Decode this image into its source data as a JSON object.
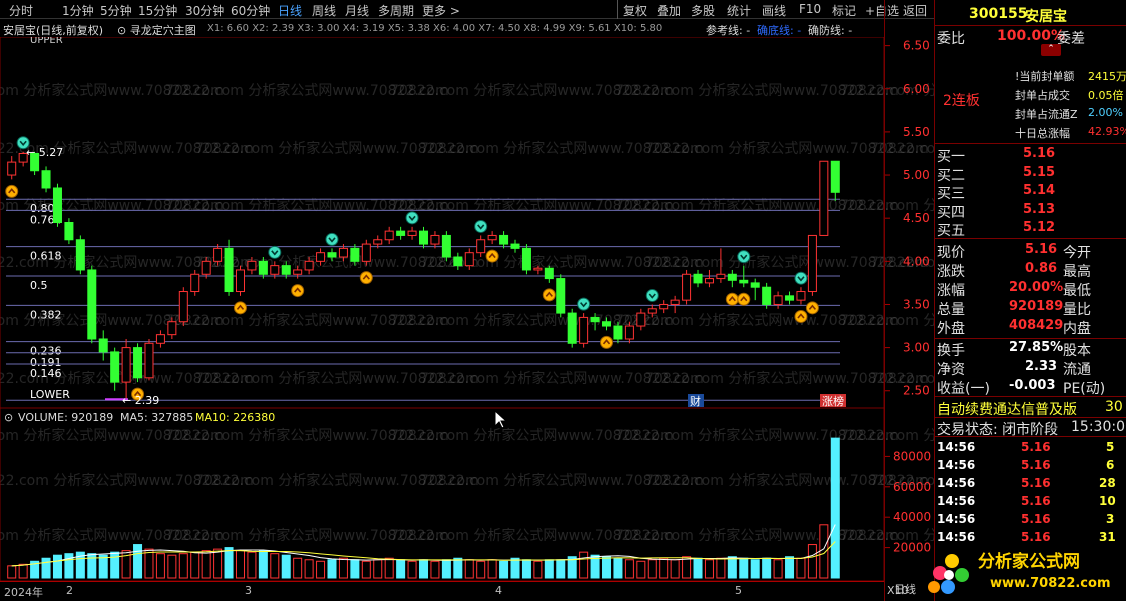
{
  "toolbar": {
    "items": [
      "分时",
      "1分钟",
      "5分钟",
      "15分钟",
      "30分钟",
      "60分钟",
      "日线",
      "周线",
      "月线",
      "多周期",
      "更多 >"
    ],
    "right_items": [
      "复权",
      "叠加",
      "多股",
      "统计",
      "画线",
      "F10",
      "标记",
      "+自选",
      "返回"
    ]
  },
  "infobar": {
    "stock": "安居宝(日线,前复权)",
    "indicator": "寻龙定穴主图",
    "params": "X1: 6.60  X2: 2.39  X3: 3.00  X4: 3.19  X5: 3.38  X6: 4.00  X7: 4.50  X8: 4.99  X9: 5.61  X10: 5.80",
    "ref": "参考线: -",
    "bottom_line": "确底线: -",
    "defense_line": "确防线: -"
  },
  "main_chart": {
    "y_ticks": [
      "6.50",
      "6.00",
      "5.50",
      "5.00",
      "4.50",
      "4.00",
      "3.50",
      "3.00",
      "2.50"
    ],
    "upper_label": "UPPER",
    "lower_label": "LOWER",
    "fib_labels": [
      "0.809",
      "0.764",
      "0.618",
      "0.5",
      "0.382",
      "0.236",
      "0.191",
      "0.146"
    ],
    "high_label": "5.27",
    "low_label": "2.39",
    "badge_cai": "财",
    "badge_zhangting": "涨榜"
  },
  "chart_data": {
    "type": "candlestick",
    "title": "",
    "ylim": [
      2.3,
      6.6
    ],
    "up_color": "#ff3333",
    "down_color": "#33ff33",
    "candles": [
      [
        5.0,
        5.15,
        5.22,
        4.95
      ],
      [
        5.15,
        5.25,
        5.27,
        5.1
      ],
      [
        5.25,
        5.05,
        5.27,
        5.0
      ],
      [
        5.05,
        4.85,
        5.1,
        4.8
      ],
      [
        4.85,
        4.45,
        4.9,
        4.4
      ],
      [
        4.45,
        4.25,
        4.5,
        4.2
      ],
      [
        4.25,
        3.9,
        4.3,
        3.85
      ],
      [
        3.9,
        3.1,
        3.95,
        3.05
      ],
      [
        3.1,
        2.95,
        3.2,
        2.85
      ],
      [
        2.95,
        2.6,
        3.0,
        2.5
      ],
      [
        2.6,
        3.0,
        3.1,
        2.39
      ],
      [
        3.0,
        2.65,
        3.05,
        2.6
      ],
      [
        2.65,
        3.05,
        3.1,
        2.62
      ],
      [
        3.05,
        3.15,
        3.2,
        3.0
      ],
      [
        3.15,
        3.3,
        3.35,
        3.1
      ],
      [
        3.3,
        3.65,
        3.7,
        3.25
      ],
      [
        3.65,
        3.85,
        3.9,
        3.6
      ],
      [
        3.85,
        4.0,
        4.05,
        3.8
      ],
      [
        4.0,
        4.15,
        4.2,
        3.95
      ],
      [
        4.15,
        3.65,
        4.25,
        3.6
      ],
      [
        3.65,
        3.9,
        3.95,
        3.6
      ],
      [
        3.9,
        4.0,
        4.05,
        3.85
      ],
      [
        4.0,
        3.85,
        4.05,
        3.8
      ],
      [
        3.85,
        3.95,
        4.0,
        3.8
      ],
      [
        3.95,
        3.85,
        4.0,
        3.8
      ],
      [
        3.85,
        3.9,
        3.95,
        3.8
      ],
      [
        3.9,
        4.0,
        4.05,
        3.85
      ],
      [
        4.0,
        4.1,
        4.15,
        3.95
      ],
      [
        4.1,
        4.05,
        4.15,
        4.0
      ],
      [
        4.05,
        4.15,
        4.2,
        4.0
      ],
      [
        4.15,
        4.0,
        4.2,
        3.95
      ],
      [
        4.0,
        4.2,
        4.25,
        3.95
      ],
      [
        4.2,
        4.25,
        4.3,
        4.15
      ],
      [
        4.25,
        4.35,
        4.4,
        4.2
      ],
      [
        4.35,
        4.3,
        4.4,
        4.25
      ],
      [
        4.3,
        4.35,
        4.4,
        4.25
      ],
      [
        4.35,
        4.2,
        4.4,
        4.15
      ],
      [
        4.2,
        4.3,
        4.35,
        4.15
      ],
      [
        4.3,
        4.05,
        4.35,
        4.0
      ],
      [
        4.05,
        3.95,
        4.1,
        3.9
      ],
      [
        3.95,
        4.1,
        4.15,
        3.9
      ],
      [
        4.1,
        4.25,
        4.3,
        4.05
      ],
      [
        4.25,
        4.3,
        4.35,
        4.2
      ],
      [
        4.3,
        4.2,
        4.35,
        4.15
      ],
      [
        4.2,
        4.15,
        4.25,
        4.1
      ],
      [
        4.15,
        3.9,
        4.2,
        3.85
      ],
      [
        3.9,
        3.92,
        3.95,
        3.85
      ],
      [
        3.92,
        3.8,
        3.95,
        3.75
      ],
      [
        3.8,
        3.4,
        3.85,
        3.35
      ],
      [
        3.4,
        3.05,
        3.45,
        3.0
      ],
      [
        3.05,
        3.35,
        3.4,
        3.0
      ],
      [
        3.35,
        3.3,
        3.4,
        3.2
      ],
      [
        3.3,
        3.25,
        3.35,
        3.2
      ],
      [
        3.25,
        3.1,
        3.3,
        3.05
      ],
      [
        3.1,
        3.25,
        3.3,
        3.05
      ],
      [
        3.25,
        3.4,
        3.45,
        3.2
      ],
      [
        3.4,
        3.45,
        3.5,
        3.35
      ],
      [
        3.45,
        3.5,
        3.55,
        3.4
      ],
      [
        3.5,
        3.55,
        3.6,
        3.4
      ],
      [
        3.55,
        3.85,
        3.9,
        3.5
      ],
      [
        3.85,
        3.75,
        3.9,
        3.7
      ],
      [
        3.75,
        3.8,
        3.9,
        3.7
      ],
      [
        3.8,
        3.85,
        4.15,
        3.75
      ],
      [
        3.85,
        3.78,
        3.9,
        3.7
      ],
      [
        3.78,
        3.75,
        3.95,
        3.7
      ],
      [
        3.75,
        3.7,
        3.8,
        3.55
      ],
      [
        3.7,
        3.5,
        3.75,
        3.45
      ],
      [
        3.5,
        3.6,
        3.65,
        3.45
      ],
      [
        3.6,
        3.55,
        3.65,
        3.5
      ],
      [
        3.55,
        3.65,
        3.7,
        3.5
      ],
      [
        3.65,
        4.3,
        4.3,
        3.6
      ],
      [
        4.3,
        5.16,
        5.16,
        4.3
      ],
      [
        5.16,
        4.8,
        5.16,
        4.7
      ]
    ],
    "fib_levels": [
      0.809,
      0.764,
      0.618,
      0.5,
      0.382,
      0.236,
      0.191,
      0.146
    ],
    "bottom_signals": [
      0,
      11,
      20,
      25,
      31,
      42,
      47,
      52,
      63,
      64,
      69,
      70
    ],
    "top_signals": [
      1,
      23,
      28,
      35,
      41,
      50,
      56,
      64,
      69
    ],
    "volume": {
      "label": "VOLUME: 920189",
      "ma5_label": "MA5: 327885",
      "ma10_label": "MA10: 226380",
      "y_ticks": [
        "80000",
        "60000",
        "40000",
        "20000"
      ],
      "ylim": [
        0,
        100000
      ],
      "values": [
        8000,
        9000,
        11000,
        13000,
        15000,
        16000,
        17000,
        16000,
        15000,
        17000,
        18000,
        22000,
        19000,
        16000,
        15000,
        16000,
        17000,
        18000,
        19000,
        20000,
        18000,
        17000,
        18000,
        16000,
        15000,
        13000,
        12000,
        11000,
        12000,
        13000,
        12000,
        11000,
        12000,
        13000,
        12000,
        11000,
        12000,
        11000,
        12000,
        13000,
        12000,
        11000,
        12000,
        11000,
        13000,
        12000,
        11000,
        12000,
        12000,
        14000,
        17000,
        15000,
        14000,
        13000,
        12000,
        11000,
        12000,
        13000,
        12000,
        14000,
        13000,
        12000,
        13000,
        14000,
        13000,
        12000,
        13000,
        12000,
        14000,
        13000,
        22000,
        35000,
        92019
      ]
    }
  },
  "xaxis": {
    "labels": [
      "2024年",
      "2",
      "3",
      "4",
      "5"
    ],
    "right_label": "X10",
    "corner_label": "日线"
  },
  "right_panel": {
    "code": "300155",
    "name": "安居宝",
    "weibi_label": "委比",
    "weibi_value": "100.00%",
    "weicha_label": "委差",
    "lianban": "2连板",
    "fengdan_rows": [
      {
        "label": "!当前封单额",
        "value": "2415万"
      },
      {
        "label": "封单占成交",
        "value": "0.05倍"
      },
      {
        "label": "封单占流通Z",
        "value": "2.00%"
      },
      {
        "label": "十日总涨幅",
        "value": "42.93%"
      }
    ],
    "buy": [
      {
        "label": "买一",
        "price": "5.16"
      },
      {
        "label": "买二",
        "price": "5.15"
      },
      {
        "label": "买三",
        "price": "5.14"
      },
      {
        "label": "买四",
        "price": "5.13"
      },
      {
        "label": "买五",
        "price": "5.12"
      }
    ],
    "quote": [
      {
        "l": "现价",
        "v": "5.16",
        "r": "今开"
      },
      {
        "l": "涨跌",
        "v": "0.86",
        "r": "最高"
      },
      {
        "l": "涨幅",
        "v": "20.00%",
        "r": "最低"
      },
      {
        "l": "总量",
        "v": "920189",
        "r": "量比"
      },
      {
        "l": "外盘",
        "v": "408429",
        "r": "内盘"
      }
    ],
    "stats": [
      {
        "l": "换手",
        "v": "27.85%",
        "r": "股本"
      },
      {
        "l": "净资",
        "v": "2.33",
        "r": "流通"
      },
      {
        "l": "收益(一)",
        "v": "-0.003",
        "r": "PE(动)"
      }
    ],
    "ticker": "自动续费通达信普及版",
    "ticker_num": "30",
    "trade_status": "交易状态: 闭市阶段",
    "trade_time": "15:30:0",
    "ticks": [
      {
        "t": "14:56",
        "p": "5.16",
        "v": "5"
      },
      {
        "t": "14:56",
        "p": "5.16",
        "v": "6"
      },
      {
        "t": "14:56",
        "p": "5.16",
        "v": "28"
      },
      {
        "t": "14:56",
        "p": "5.16",
        "v": "10"
      },
      {
        "t": "14:56",
        "p": "5.16",
        "v": "3"
      },
      {
        "t": "14:56",
        "p": "5.16",
        "v": "31"
      }
    ],
    "logo_text": "分析家公式网",
    "logo_url": "www.70822.com"
  },
  "watermark": "70822.com 分析家公式网www.70822.com"
}
